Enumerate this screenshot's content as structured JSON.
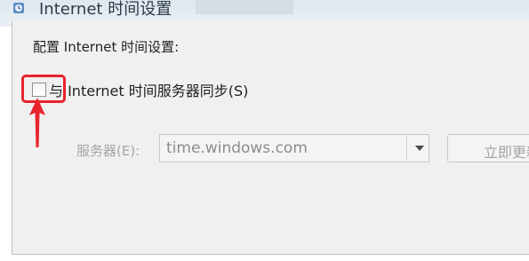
{
  "window": {
    "title": "Internet 时间设置",
    "icon": "clock-settings-icon"
  },
  "dialog": {
    "heading": "配置 Internet 时间设置:",
    "sync_checkbox": {
      "label": "与 Internet 时间服务器同步(S)",
      "checked": false
    },
    "server": {
      "label": "服务器(E):",
      "value": "time.windows.com",
      "enabled": false
    },
    "update_button": {
      "label": "立即更新",
      "enabled": false
    }
  },
  "annotation": {
    "color": "#e8232d"
  }
}
